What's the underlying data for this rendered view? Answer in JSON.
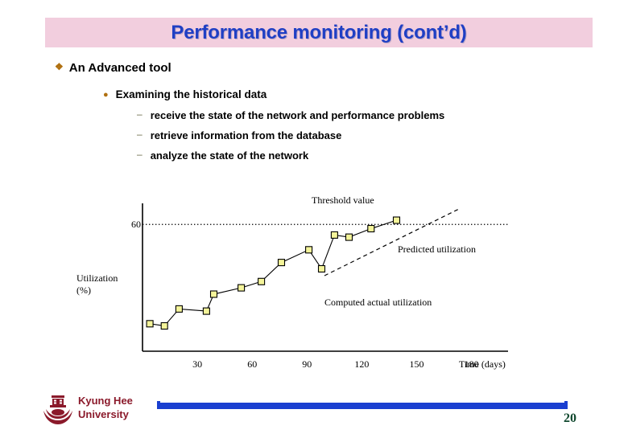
{
  "slide": {
    "title": "Performance monitoring (cont’d)",
    "title_band_color": "#f2cede",
    "title_text_color": "#1f3fc4"
  },
  "outline": {
    "level1": {
      "bullet": "❖",
      "text": "An Advanced tool"
    },
    "level2": {
      "bullet": "●",
      "text": "Examining the historical data"
    },
    "level3": [
      {
        "bullet": "–",
        "text": "receive the state of the network and performance problems"
      },
      {
        "bullet": "–",
        "text": "retrieve information from the database"
      },
      {
        "bullet": "–",
        "text": "analyze the state of the network"
      }
    ]
  },
  "chart_data": {
    "type": "scatter",
    "title": "",
    "xlabel": "Time (days)",
    "ylabel": "Utilization (%)",
    "ylabel_lines": [
      "Utilization",
      "(%)"
    ],
    "xticks": [
      30,
      60,
      90,
      120,
      150,
      180
    ],
    "xtick_labels": [
      "30",
      "60",
      "90",
      "120",
      "150",
      "180"
    ],
    "yticks": [
      60
    ],
    "ytick_labels": [
      "60"
    ],
    "xlim": [
      0,
      200
    ],
    "ylim": [
      0,
      70
    ],
    "grid": false,
    "marker_fill": "#f4f49a",
    "marker_stroke": "#000000",
    "annotations": [
      {
        "name": "threshold",
        "text": "Threshold value",
        "value": 60
      },
      {
        "name": "predicted",
        "text": "Predicted utilization"
      },
      {
        "name": "computed",
        "text": "Computed actual utilization"
      }
    ],
    "series": [
      {
        "name": "Computed actual utilization",
        "style": "scatter-with-trend",
        "x": [
          4,
          12,
          20,
          35,
          39,
          54,
          65,
          76,
          91,
          98,
          105,
          113,
          125,
          139
        ],
        "y": [
          13,
          12,
          20,
          19,
          27,
          30,
          33,
          42,
          48,
          39,
          55,
          54,
          58,
          62
        ]
      },
      {
        "name": "Predicted utilization",
        "style": "dashed-line",
        "x": [
          0,
          160
        ],
        "y": [
          9,
          72
        ]
      },
      {
        "name": "Threshold value",
        "style": "dotted-line",
        "x": [
          0,
          200
        ],
        "y": [
          60,
          60
        ]
      }
    ]
  },
  "footer": {
    "organization_line1": "Kyung Hee",
    "organization_line2": "University",
    "logo_name": "kyung-hee-university-crest",
    "bar_color": "#1a3fd0",
    "page_number": "20"
  }
}
